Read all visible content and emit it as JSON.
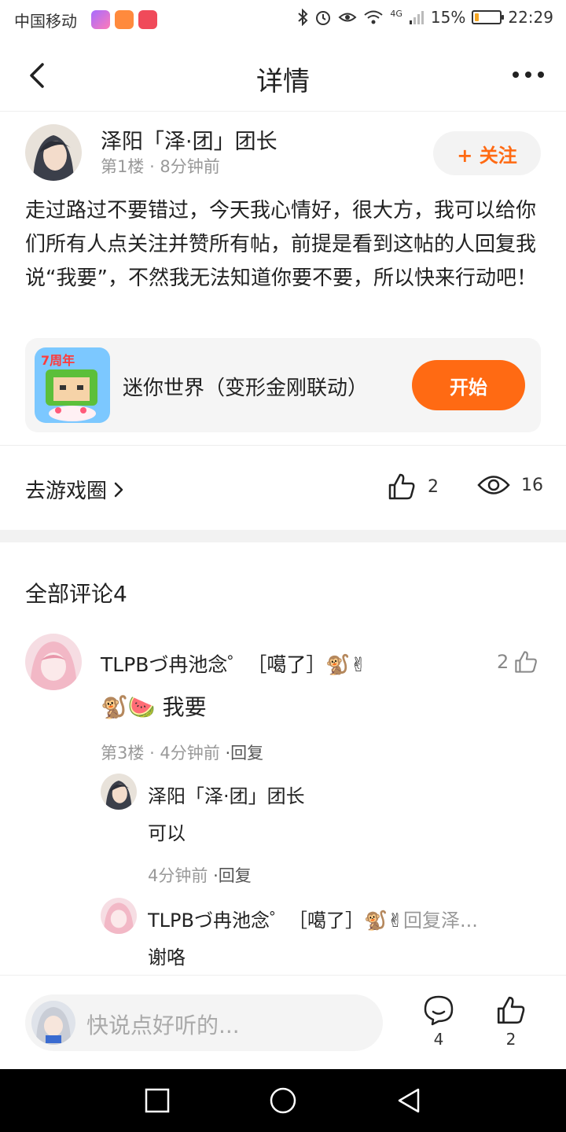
{
  "status_bar": {
    "carrier": "中国移动",
    "network": "4G",
    "battery": "15%",
    "battery_level": 0.15,
    "time": "22:29"
  },
  "header": {
    "title": "详情"
  },
  "post": {
    "author": "泽阳「泽·团」团长",
    "floor": "第1楼",
    "time": "8分钟前",
    "follow_label": "+ 关注",
    "body": "走过路过不要错过，今天我心情好，很大方，我可以给你们所有人点关注并赞所有帖，前提是看到这帖的人回复我说“我要”，不然我无法知道你要不要，所以快来行动吧！",
    "game": {
      "name": "迷你世界（变形金刚联动）",
      "start_label": "开始",
      "icon_text": "7周年"
    },
    "circle_link": "去游戏圈",
    "likes": "2",
    "views": "16"
  },
  "comments": {
    "title": "全部评论4",
    "items": [
      {
        "author": "TLPBづ冉池念゜［噶了］🐒✌",
        "text": "🐒🍉 我要",
        "floor": "第3楼",
        "time": "4分钟前",
        "reply_label": "·回复",
        "likes": "2",
        "replies": [
          {
            "author": "泽阳「泽·团」团长",
            "text": "可以",
            "time": "4分钟前",
            "reply_label": "·回复"
          },
          {
            "author": "TLPBづ冉池念゜［噶了］🐒✌",
            "reply_to": "回复泽...",
            "text": "谢咯"
          }
        ]
      }
    ]
  },
  "bottom_bar": {
    "placeholder": "快说点好听的...",
    "comment_count": "4",
    "like_count": "2"
  },
  "colors": {
    "accent": "#ff6a13",
    "muted": "#999999"
  }
}
